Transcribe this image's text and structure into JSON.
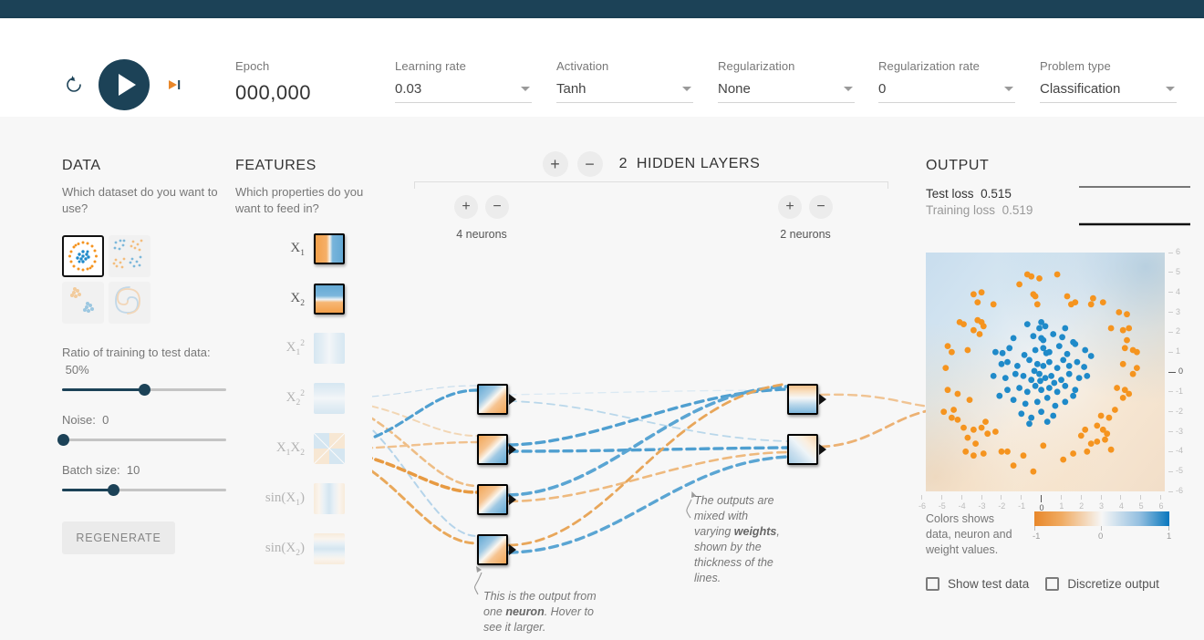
{
  "topbar": {
    "color": "#1c4257"
  },
  "header": {
    "playback": {
      "reset_label": "reset",
      "play_label": "play",
      "step_label": "step"
    },
    "epoch": {
      "label": "Epoch",
      "value": "000,000"
    },
    "controls": [
      {
        "label": "Learning rate",
        "value": "0.03"
      },
      {
        "label": "Activation",
        "value": "Tanh"
      },
      {
        "label": "Regularization",
        "value": "None"
      },
      {
        "label": "Regularization rate",
        "value": "0"
      },
      {
        "label": "Problem type",
        "value": "Classification"
      }
    ]
  },
  "data": {
    "title": "DATA",
    "question": "Which dataset do you want to use?",
    "datasets": [
      {
        "name": "circle",
        "selected": true
      },
      {
        "name": "exclusive-or",
        "selected": false
      },
      {
        "name": "gaussian",
        "selected": false
      },
      {
        "name": "spiral",
        "selected": false
      }
    ],
    "ratio": {
      "label": "Ratio of training to test data:",
      "value": "50%",
      "pct": 50
    },
    "noise": {
      "label": "Noise:",
      "value": "0",
      "pct": 0
    },
    "batch": {
      "label": "Batch size:",
      "value": "10",
      "pct": 18
    },
    "regenerate_label": "REGENERATE"
  },
  "features": {
    "title": "FEATURES",
    "question": "Which properties do you want to feed in?",
    "items": [
      {
        "name": "X1",
        "label_html": "X<sub>1</sub>",
        "active": true
      },
      {
        "name": "X2",
        "label_html": "X<sub>2</sub>",
        "active": true
      },
      {
        "name": "X1sq",
        "label_html": "X<sub>1</sub><sup>2</sup>",
        "active": false
      },
      {
        "name": "X2sq",
        "label_html": "X<sub>2</sub><sup>2</sup>",
        "active": false
      },
      {
        "name": "X1X2",
        "label_html": "X<sub>1</sub>X<sub>2</sub>",
        "active": false
      },
      {
        "name": "sinX1",
        "label_html": "sin(X<sub>1</sub>)",
        "active": false
      },
      {
        "name": "sinX2",
        "label_html": "sin(X<sub>2</sub>)",
        "active": false
      }
    ]
  },
  "network": {
    "hidden_layer_count": "2",
    "hidden_layers_label": "HIDDEN LAYERS",
    "add_layer_label": "+",
    "remove_layer_label": "−",
    "layers": [
      {
        "neuron_count": 4,
        "caption": "4 neurons"
      },
      {
        "neuron_count": 2,
        "caption": "2 neurons"
      }
    ],
    "callout_neuron": {
      "pre": "This is the output from one ",
      "bold": "neuron",
      "post": ". Hover to see it larger."
    },
    "callout_weights": {
      "pre": "The outputs are mixed with varying ",
      "bold": "weights",
      "post": ", shown by the thickness of the lines."
    }
  },
  "output": {
    "title": "OUTPUT",
    "test_loss_label": "Test loss",
    "test_loss_value": "0.515",
    "training_loss_label": "Training loss",
    "training_loss_value": "0.519",
    "axis_ticks": [
      "-6",
      "-5",
      "-4",
      "-3",
      "-2",
      "-1",
      "0",
      "1",
      "2",
      "3",
      "4",
      "5",
      "6"
    ],
    "legend_text": "Colors shows data, neuron and weight values.",
    "legend_min": "-1",
    "legend_mid": "0",
    "legend_max": "1",
    "show_test_data_label": "Show test data",
    "discretize_output_label": "Discretize output",
    "show_test_data_checked": false,
    "discretize_checked": false
  },
  "colors": {
    "negative": "#e8872a",
    "positive": "#0877bd",
    "neutral": "#f2f2f2",
    "accent_dark": "#1c4257"
  },
  "chart_data": {
    "type": "scatter",
    "title": "Output decision boundary (circle dataset)",
    "xlabel": "",
    "ylabel": "",
    "xlim": [
      -6,
      6
    ],
    "ylim": [
      -6,
      6
    ],
    "grid": false,
    "legend": "none",
    "series": [
      {
        "name": "class-positive-blue",
        "color": "#1f8ac9",
        "points": [
          [
            -0.9,
            2.4
          ],
          [
            -0.2,
            2.5
          ],
          [
            -0.3,
            2.2
          ],
          [
            0.0,
            2.3
          ],
          [
            1.0,
            2.2
          ],
          [
            -1.6,
            1.7
          ],
          [
            -0.6,
            1.8
          ],
          [
            -0.2,
            1.7
          ],
          [
            -0.1,
            1.6
          ],
          [
            0.4,
            1.9
          ],
          [
            1.4,
            1.5
          ],
          [
            1.5,
            1.4
          ],
          [
            2.0,
            1.1
          ],
          [
            -2.5,
            1.0
          ],
          [
            -1.8,
            1.2
          ],
          [
            -0.5,
            1.1
          ],
          [
            -0.1,
            1.2
          ],
          [
            0.2,
            1.0
          ],
          [
            0.7,
            1.3
          ],
          [
            1.1,
            0.9
          ],
          [
            2.3,
            0.8
          ],
          [
            -2.2,
            0.4
          ],
          [
            -1.9,
            0.5
          ],
          [
            -1.4,
            0.3
          ],
          [
            -0.8,
            0.6
          ],
          [
            -0.4,
            0.4
          ],
          [
            -0.1,
            0.3
          ],
          [
            0.2,
            0.5
          ],
          [
            0.6,
            0.2
          ],
          [
            0.9,
            0.6
          ],
          [
            1.2,
            0.3
          ],
          [
            1.6,
            0.5
          ],
          [
            -2.6,
            -0.2
          ],
          [
            -2.0,
            -0.3
          ],
          [
            -1.5,
            -0.1
          ],
          [
            -1.1,
            -0.2
          ],
          [
            -0.7,
            -0.4
          ],
          [
            -0.3,
            -0.1
          ],
          [
            0.0,
            -0.3
          ],
          [
            0.3,
            -0.2
          ],
          [
            0.8,
            -0.4
          ],
          [
            1.2,
            -0.1
          ],
          [
            1.7,
            -0.3
          ],
          [
            2.1,
            -0.2
          ],
          [
            -1.9,
            -0.9
          ],
          [
            -1.3,
            -0.8
          ],
          [
            -0.9,
            -1.0
          ],
          [
            -0.5,
            -0.7
          ],
          [
            -0.2,
            -0.9
          ],
          [
            0.2,
            -0.8
          ],
          [
            0.6,
            -1.0
          ],
          [
            1.0,
            -0.7
          ],
          [
            1.5,
            -0.9
          ],
          [
            -2.3,
            -1.2
          ],
          [
            -1.6,
            -1.4
          ],
          [
            -1.0,
            -1.6
          ],
          [
            -0.4,
            -1.5
          ],
          [
            0.1,
            -1.3
          ],
          [
            0.5,
            -1.7
          ],
          [
            1.0,
            -1.5
          ],
          [
            1.4,
            -1.2
          ],
          [
            -1.2,
            -2.1
          ],
          [
            -0.7,
            -2.3
          ],
          [
            -0.2,
            -2.0
          ],
          [
            0.4,
            -2.2
          ],
          [
            -0.8,
            -2.6
          ],
          [
            0.1,
            -2.5
          ],
          [
            -0.55,
            0.05
          ],
          [
            -0.25,
            -0.45
          ],
          [
            0.05,
            0.95
          ],
          [
            0.45,
            -0.55
          ],
          [
            0.85,
            1.75
          ],
          [
            -1.05,
            0.85
          ],
          [
            1.95,
            0.25
          ],
          [
            -2.15,
            0.95
          ]
        ]
      },
      {
        "name": "class-negative-orange",
        "color": "#f5941f",
        "points": [
          [
            -0.9,
            4.9
          ],
          [
            -0.7,
            4.8
          ],
          [
            -0.3,
            4.7
          ],
          [
            0.6,
            4.9
          ],
          [
            -1.3,
            4.4
          ],
          [
            -3.2,
            4.0
          ],
          [
            -3.6,
            3.9
          ],
          [
            -3.4,
            3.5
          ],
          [
            -2.6,
            3.4
          ],
          [
            -0.5,
            3.8
          ],
          [
            -0.6,
            3.9
          ],
          [
            1.1,
            3.8
          ],
          [
            1.3,
            3.4
          ],
          [
            1.5,
            3.5
          ],
          [
            2.4,
            3.7
          ],
          [
            2.3,
            3.4
          ],
          [
            2.9,
            3.5
          ],
          [
            -0.4,
            3.4
          ],
          [
            3.7,
            3.0
          ],
          [
            4.1,
            2.9
          ],
          [
            -4.3,
            2.5
          ],
          [
            -4.1,
            2.4
          ],
          [
            -3.4,
            2.6
          ],
          [
            -3.2,
            2.5
          ],
          [
            -3.1,
            2.3
          ],
          [
            -3.6,
            2.1
          ],
          [
            -3.3,
            1.9
          ],
          [
            3.3,
            2.2
          ],
          [
            3.9,
            2.1
          ],
          [
            4.2,
            2.2
          ],
          [
            -4.9,
            1.3
          ],
          [
            -4.7,
            1.0
          ],
          [
            -3.9,
            1.1
          ],
          [
            4.1,
            1.6
          ],
          [
            4.0,
            1.2
          ],
          [
            4.6,
            1.0
          ],
          [
            4.4,
            1.1
          ],
          [
            -5.0,
            0.2
          ],
          [
            3.9,
            0.4
          ],
          [
            4.6,
            0.2
          ],
          [
            4.4,
            -0.1
          ],
          [
            -4.9,
            -0.9
          ],
          [
            -4.4,
            -1.1
          ],
          [
            -3.8,
            -1.4
          ],
          [
            3.6,
            -0.8
          ],
          [
            4.0,
            -0.9
          ],
          [
            4.2,
            -1.1
          ],
          [
            3.9,
            -1.3
          ],
          [
            -5.1,
            -2.0
          ],
          [
            -4.7,
            -2.3
          ],
          [
            -4.4,
            -2.4
          ],
          [
            -4.1,
            -2.8
          ],
          [
            3.5,
            -1.9
          ],
          [
            3.2,
            -2.3
          ],
          [
            -3.6,
            -2.9
          ],
          [
            -3.2,
            -2.8
          ],
          [
            -2.9,
            -3.1
          ],
          [
            -2.5,
            -3.0
          ],
          [
            -3.9,
            -3.3
          ],
          [
            -3.5,
            -3.6
          ],
          [
            2.0,
            -2.9
          ],
          [
            2.6,
            -2.7
          ],
          [
            2.9,
            -2.9
          ],
          [
            3.1,
            -3.1
          ],
          [
            -4.0,
            -4.0
          ],
          [
            -3.6,
            -4.2
          ],
          [
            -3.1,
            -4.1
          ],
          [
            -2.2,
            -4.0
          ],
          [
            -1.9,
            -4.0
          ],
          [
            -1.1,
            -4.2
          ],
          [
            -0.1,
            -3.7
          ],
          [
            1.4,
            -4.1
          ],
          [
            2.1,
            -4.0
          ],
          [
            2.6,
            -3.5
          ],
          [
            3.0,
            -3.4
          ],
          [
            3.3,
            -3.9
          ],
          [
            -1.6,
            -4.7
          ],
          [
            -0.6,
            -5.0
          ],
          [
            0.9,
            -4.4
          ],
          [
            1.8,
            -3.2
          ],
          [
            2.3,
            -3.6
          ],
          [
            -4.6,
            -1.9
          ],
          [
            -3.0,
            -2.5
          ],
          [
            2.8,
            -2.2
          ]
        ]
      }
    ],
    "background": {
      "description": "Soft decision-surface gradient: blue wash across the upper-right half, orange wash across the lower-left half, near-white along the diagonal separator.",
      "blue_hex": "#cfe0ee",
      "orange_hex": "#f4e3cf"
    }
  },
  "loss_chart": {
    "type": "line",
    "title": "Loss over epochs",
    "series": [
      {
        "name": "Test loss",
        "color": "#777777",
        "values": [
          0.515,
          0.515
        ]
      },
      {
        "name": "Training loss",
        "color": "#222222",
        "values": [
          0.519,
          0.519
        ]
      }
    ],
    "x": [
      0,
      1
    ],
    "ylim": [
      0,
      1
    ]
  }
}
